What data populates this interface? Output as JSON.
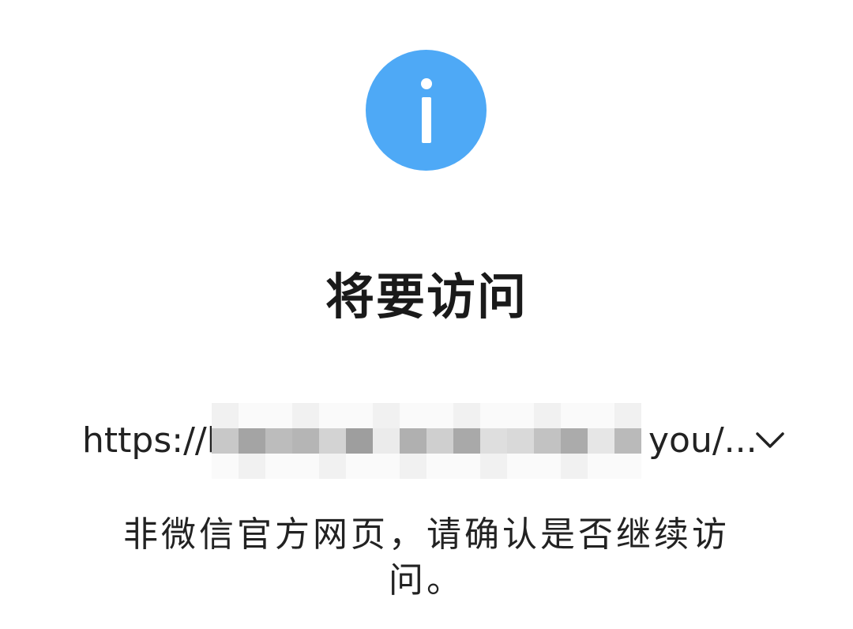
{
  "dialog": {
    "icon": "info-icon",
    "icon_color": "#4ea9f6",
    "title": "将要访问",
    "url_prefix": "https://k",
    "url_suffix": "you/...",
    "expand_icon": "chevron-down-icon",
    "notice": "非微信官方网页，请确认是否继续访问。"
  }
}
